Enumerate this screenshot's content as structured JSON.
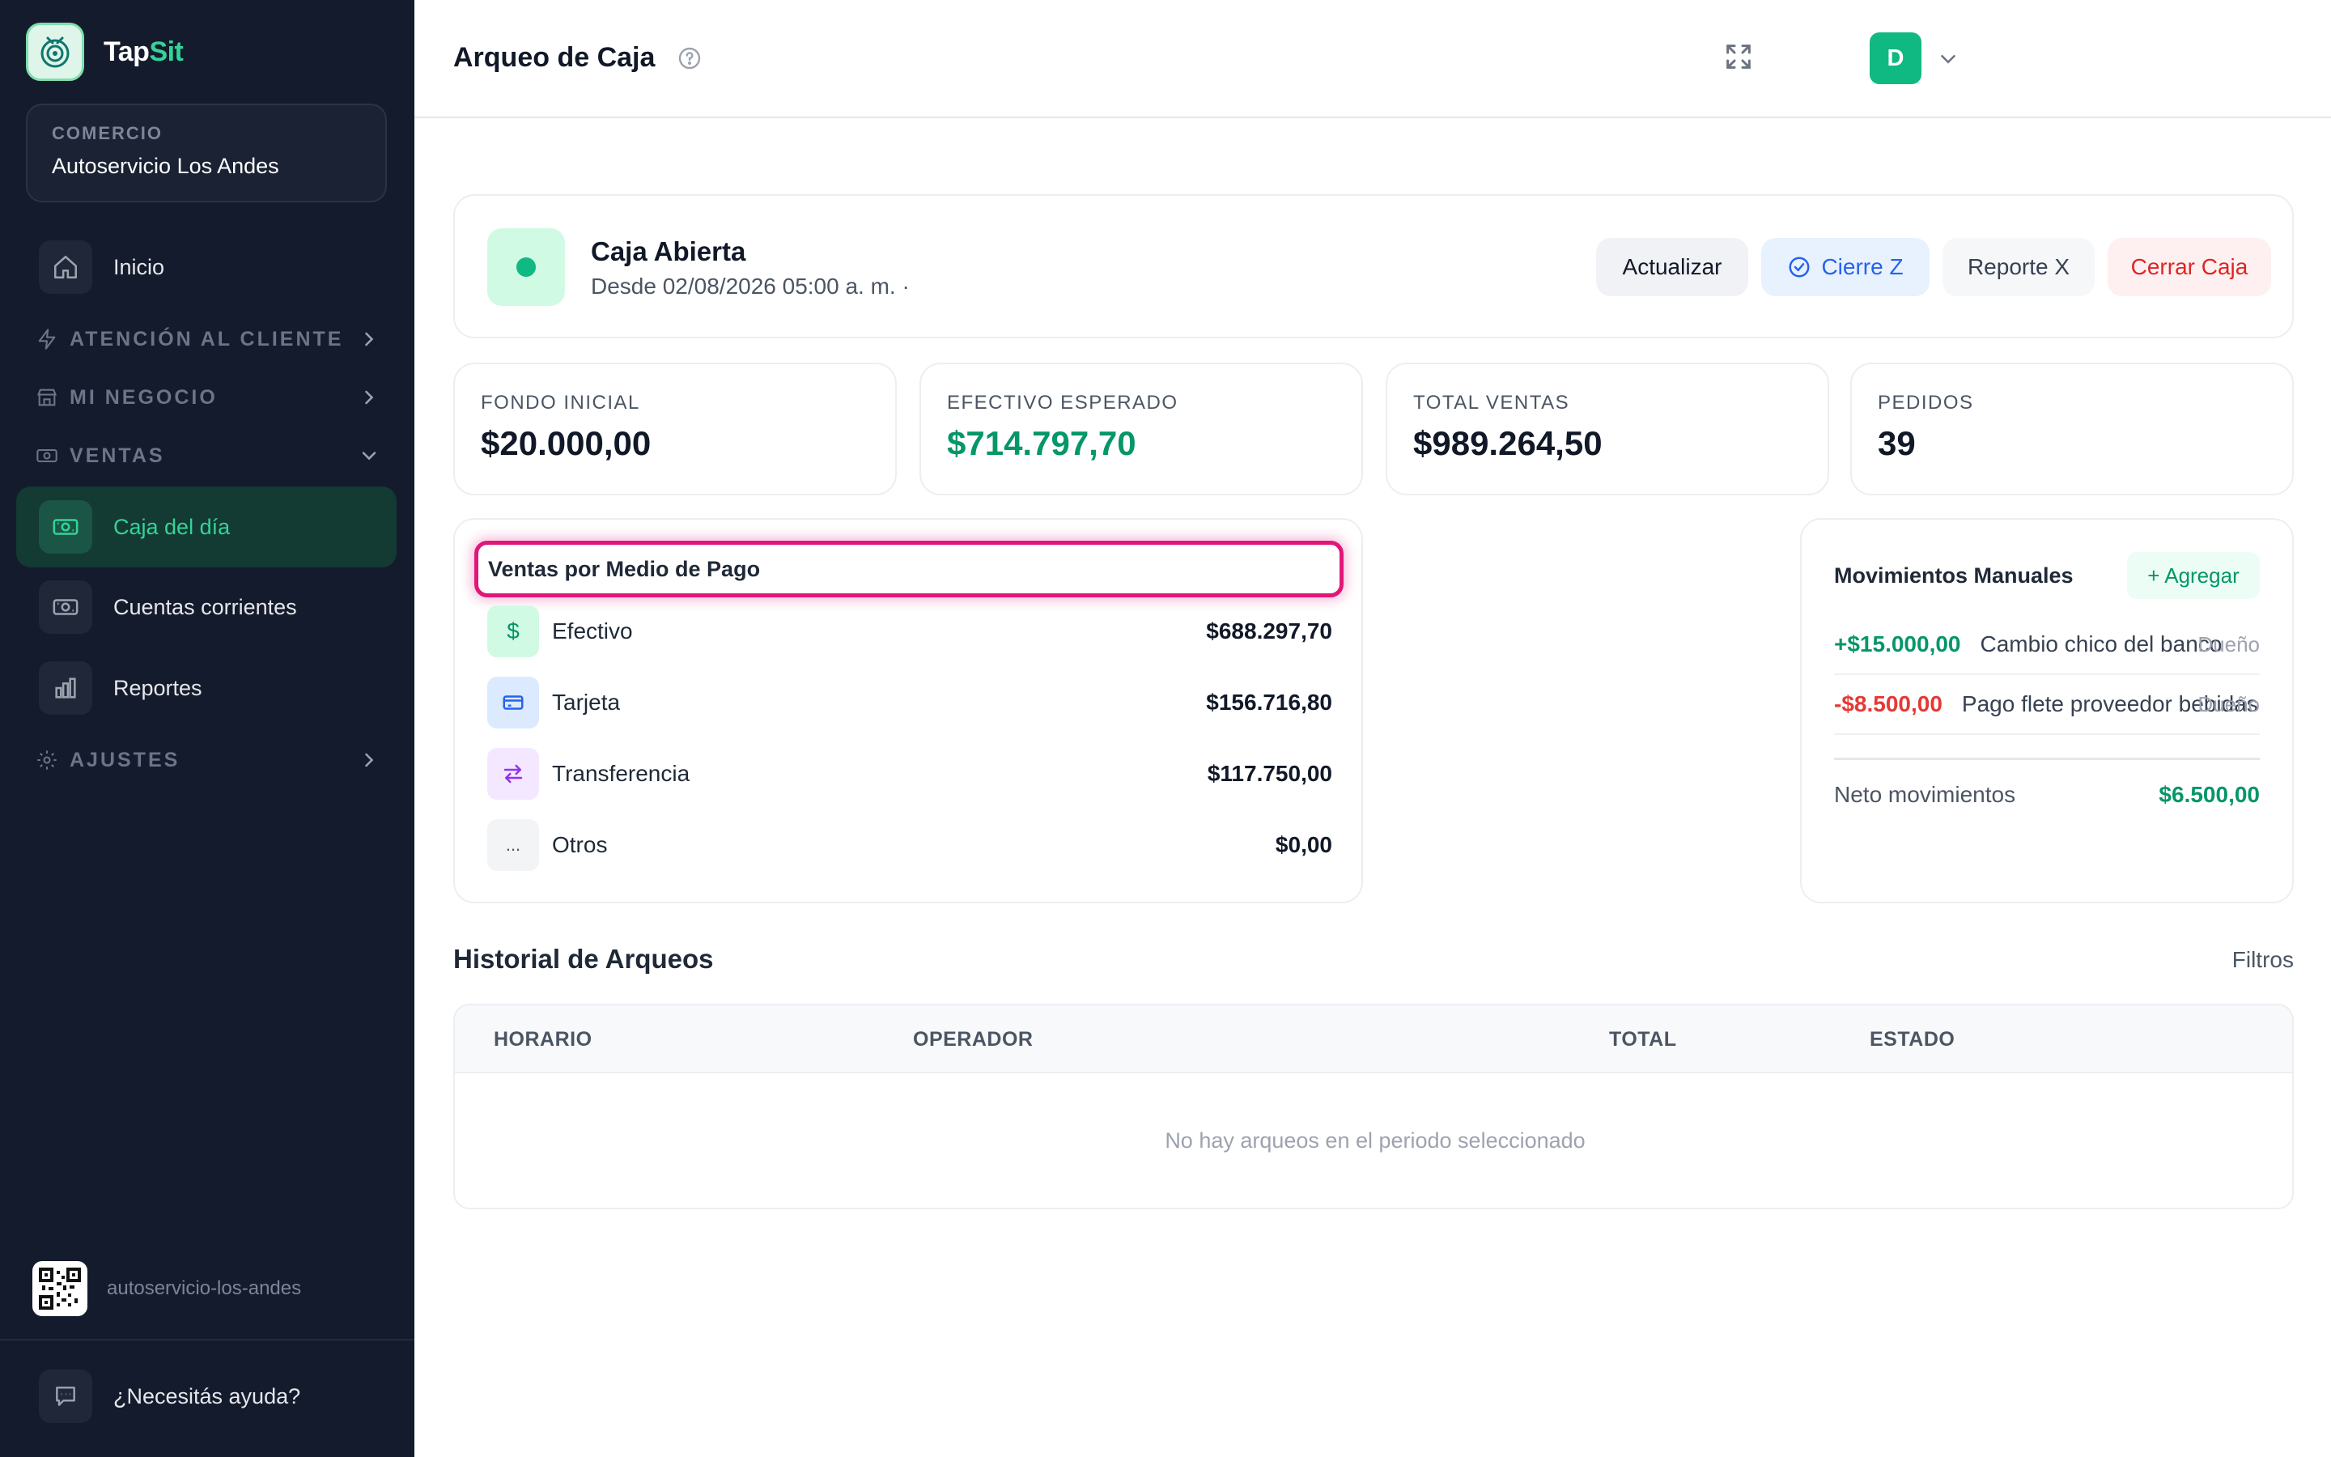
{
  "brand": {
    "name_part1": "Tap",
    "name_part2": "Sit"
  },
  "sidebar": {
    "store_label": "COMERCIO",
    "store_name": "Autoservicio Los Andes",
    "items": {
      "inicio": "Inicio",
      "atencion": "ATENCIÓN AL CLIENTE",
      "negocio": "MI NEGOCIO",
      "ventas": "VENTAS",
      "caja": "Caja del día",
      "cuentas": "Cuentas corrientes",
      "reportes": "Reportes",
      "ajustes": "AJUSTES"
    },
    "store_slug": "autoservicio-los-andes",
    "help": "¿Necesitás ayuda?",
    "active_color": "#34d399"
  },
  "header": {
    "title": "Arqueo de Caja",
    "avatar_initial": "D"
  },
  "status": {
    "title": "Caja Abierta",
    "subtitle": "Desde 02/08/2026 05:00 a. m. ·",
    "buttons": {
      "refresh": "Actualizar",
      "cierre_z": "Cierre Z",
      "reporte_x": "Reporte X",
      "cerrar": "Cerrar Caja"
    }
  },
  "stats": [
    {
      "label": "FONDO INICIAL",
      "value": "$20.000,00"
    },
    {
      "label": "EFECTIVO ESPERADO",
      "value": "$714.797,70"
    },
    {
      "label": "TOTAL VENTAS",
      "value": "$989.264,50"
    },
    {
      "label": "PEDIDOS",
      "value": "39"
    }
  ],
  "payments": {
    "title": "Ventas por Medio de Pago",
    "rows": [
      {
        "icon": "$",
        "label": "Efectivo",
        "value": "$688.297,70"
      },
      {
        "icon": "card-icon",
        "label": "Tarjeta",
        "value": "$156.716,80"
      },
      {
        "icon": "transfer-icon",
        "label": "Transferencia",
        "value": "$117.750,00"
      },
      {
        "icon": "...",
        "label": "Otros",
        "value": "$0,00"
      }
    ]
  },
  "movements": {
    "title": "Movimientos Manuales",
    "add_label": "+ Agregar",
    "rows": [
      {
        "amount": "+$15.000,00",
        "desc": "Cambio chico del banco",
        "who": "Dueño"
      },
      {
        "amount": "-$8.500,00",
        "desc": "Pago flete proveedor bebidas",
        "who": "Dueño"
      }
    ],
    "net_label": "Neto movimientos",
    "net_value": "$6.500,00"
  },
  "history": {
    "title": "Historial de Arqueos",
    "filter": "Filtros",
    "columns": [
      "HORARIO",
      "OPERADOR",
      "TOTAL",
      "ESTADO"
    ],
    "empty": "No hay arqueos en el periodo seleccionado"
  }
}
